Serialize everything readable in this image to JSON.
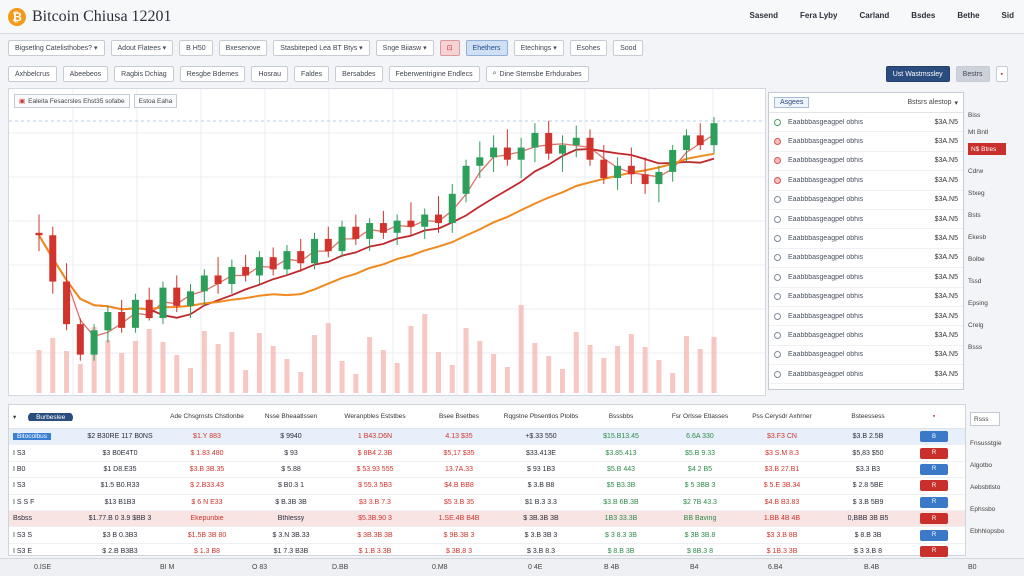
{
  "app": {
    "title": "Bitcoin Chiusa 12201",
    "logo_glyph": "₿"
  },
  "top_menu": [
    "Sasend",
    "Fera Lyby",
    "Carland",
    "Bsdes",
    "Bethe",
    "Sid"
  ],
  "toolbar1": [
    {
      "label": "Bigsetlng Catelisthobes? ▾"
    },
    {
      "label": "Adout Flatees ▾"
    },
    {
      "label": "B H50"
    },
    {
      "label": "Bxesenove"
    },
    {
      "label": "Stasbiteped Lea BT Btys ▾"
    },
    {
      "label": "Snge Biiasw ▾"
    },
    {
      "label": "Ehethers"
    },
    {
      "label": "Etechings ▾"
    },
    {
      "label": "Esohes"
    },
    {
      "label": "Sood"
    }
  ],
  "toolbar2": [
    {
      "label": "Axhbelcrus"
    },
    {
      "label": "Abeebeos"
    },
    {
      "label": "Ragbis Dchiag"
    },
    {
      "label": "Resgbe Bdemes"
    },
    {
      "label": "Hosrau"
    },
    {
      "label": "Faldes"
    },
    {
      "label": "Bersabdes"
    },
    {
      "label": "Feberwentrigine Endlecs"
    },
    {
      "label": "Dine Stemsbe Erhdurabes"
    }
  ],
  "toolbar2_right": {
    "primary": "Ust Wastmssley",
    "secondary": "Bestrs"
  },
  "chart_legend": {
    "series": "Ealeita Fesacrsles Ehst35 sofabe",
    "ma": "Estoa Eaha"
  },
  "colors": {
    "up": "#2e9e5b",
    "down": "#d0342c",
    "ma_fast": "#e0706a",
    "ma_mid": "#c0272d",
    "ma_slow": "#f08a1e",
    "volume": "#f4b4b0"
  },
  "chart_data": {
    "type": "candlestick",
    "title": "",
    "candles": [
      [
        200,
        215,
        185,
        198
      ],
      [
        198,
        205,
        150,
        160
      ],
      [
        160,
        175,
        120,
        125
      ],
      [
        125,
        130,
        95,
        100
      ],
      [
        100,
        125,
        95,
        120
      ],
      [
        120,
        140,
        110,
        135
      ],
      [
        135,
        145,
        118,
        122
      ],
      [
        122,
        150,
        118,
        145
      ],
      [
        145,
        155,
        128,
        130
      ],
      [
        130,
        160,
        125,
        155
      ],
      [
        155,
        165,
        135,
        140
      ],
      [
        140,
        158,
        130,
        152
      ],
      [
        152,
        170,
        140,
        165
      ],
      [
        165,
        180,
        150,
        158
      ],
      [
        158,
        178,
        150,
        172
      ],
      [
        172,
        182,
        160,
        165
      ],
      [
        165,
        185,
        158,
        180
      ],
      [
        180,
        188,
        165,
        170
      ],
      [
        170,
        190,
        165,
        185
      ],
      [
        185,
        195,
        168,
        175
      ],
      [
        175,
        200,
        170,
        195
      ],
      [
        195,
        205,
        180,
        185
      ],
      [
        185,
        210,
        180,
        205
      ],
      [
        205,
        215,
        190,
        195
      ],
      [
        195,
        212,
        185,
        208
      ],
      [
        208,
        218,
        195,
        200
      ],
      [
        200,
        215,
        190,
        210
      ],
      [
        210,
        225,
        198,
        205
      ],
      [
        205,
        220,
        195,
        215
      ],
      [
        215,
        230,
        200,
        208
      ],
      [
        208,
        240,
        200,
        232
      ],
      [
        232,
        260,
        225,
        255
      ],
      [
        255,
        275,
        245,
        262
      ],
      [
        262,
        280,
        250,
        270
      ],
      [
        270,
        285,
        255,
        260
      ],
      [
        260,
        278,
        245,
        270
      ],
      [
        270,
        290,
        258,
        282
      ],
      [
        282,
        292,
        260,
        265
      ],
      [
        265,
        280,
        250,
        272
      ],
      [
        272,
        288,
        262,
        278
      ],
      [
        278,
        285,
        255,
        260
      ],
      [
        260,
        272,
        240,
        245
      ],
      [
        245,
        262,
        235,
        255
      ],
      [
        255,
        270,
        240,
        248
      ],
      [
        248,
        262,
        232,
        240
      ],
      [
        240,
        255,
        225,
        250
      ],
      [
        250,
        272,
        242,
        268
      ],
      [
        268,
        285,
        258,
        280
      ],
      [
        280,
        290,
        268,
        272
      ],
      [
        272,
        295,
        265,
        290
      ]
    ],
    "moving_averages": [
      "fast",
      "mid",
      "slow"
    ]
  },
  "watchlist": {
    "tab": "Asgees",
    "sort_label": "Bstsrs alestop",
    "items": [
      {
        "name": "Eaabbbasgeagpel obhis",
        "price": "$3A.N5",
        "dot": "green"
      },
      {
        "name": "Eaabbbasgeagpel obhis",
        "price": "$3A.N5",
        "dot": "red"
      },
      {
        "name": "Eaabbbasgeagpel obhis",
        "price": "$3A.N5",
        "dot": "red"
      },
      {
        "name": "Eaabbbasgeagpel obhis",
        "price": "$3A.N5",
        "dot": "red"
      },
      {
        "name": "Eaabbbasgeagpel obhis",
        "price": "$3A.N5",
        "dot": "neutral"
      },
      {
        "name": "Eaabbbasgeagpel obhis",
        "price": "$3A.N5",
        "dot": "neutral"
      },
      {
        "name": "Eaabbbasgeagpel obhis",
        "price": "$3A.N5",
        "dot": "neutral"
      },
      {
        "name": "Eaabbbasgeagpel obhis",
        "price": "$3A.N5",
        "dot": "neutral"
      },
      {
        "name": "Eaabbbasgeagpel obhis",
        "price": "$3A.N5",
        "dot": "neutral"
      },
      {
        "name": "Eaabbbasgeagpel obhis",
        "price": "$3A.N5",
        "dot": "neutral"
      },
      {
        "name": "Eaabbbasgeagpel obhis",
        "price": "$3A.N5",
        "dot": "neutral"
      },
      {
        "name": "Eaabbbasgeagpel obhis",
        "price": "$3A.N5",
        "dot": "neutral"
      },
      {
        "name": "Eaabbbasgeagpel obhis",
        "price": "$3A.N5",
        "dot": "neutral"
      },
      {
        "name": "Eaabbbasgeagpel obhis",
        "price": "$3A.N5",
        "dot": "neutral"
      }
    ]
  },
  "side_strip": [
    "Biss",
    "Mt Bntl",
    "N$ Btres",
    "Cdrw",
    "Stxeg",
    "Bsts",
    "Ekesb",
    "Bolbe",
    "Tssd",
    "Epsing",
    "Crelg",
    "Bsss"
  ],
  "table": {
    "filter_label": "Burbeslee",
    "headers": [
      "",
      "Ade Chsgrnsts Chstlonbe",
      "Nsse Bheaatlssen",
      "Weranpbles Eststbes",
      "Bsee Bsetbes",
      "Rqgstne Pbsentlos Ptolbs",
      "Bsssbbs",
      "Fsr Orlsse Etlasses",
      "Pss Cerysdr Axhrner",
      "Bsteessess",
      "",
      ""
    ],
    "rows": [
      {
        "style": "sel",
        "cells": [
          "Bitocolbus",
          "$2 B30RE 117 B0NS",
          "$1.Y 883",
          "$ 9940",
          "1 B43.D6N",
          "4.13 $35",
          "+$.33 550",
          "$15.B13.45",
          "6.6A 330",
          "$3.F3 CN",
          "$3.B 2.5B",
          "B"
        ]
      },
      {
        "style": "",
        "cells": [
          "I S3",
          "$3 B0E4T0",
          "$ 1.83 480",
          "$ 93",
          "$ 8B4 2.3B",
          "$5,17 $35",
          "$33.413E",
          "$3.85.413",
          "$5.B 9.33",
          "$3 S.M 8.3",
          "$5,83 $50",
          "R"
        ]
      },
      {
        "style": "",
        "cells": [
          "I B0",
          "$1 D8.E35",
          "$3.B 3B.35",
          "$ 5.88",
          "$ 53.93 555",
          "13.7A.33",
          "$ 93 1B3",
          "$5.B 443",
          "$4 2 B5",
          "$3.B 27.B1",
          "$3.3 B3",
          "R"
        ]
      },
      {
        "style": "",
        "cells": [
          "I S3",
          "$1.5 B0.R33",
          "$ 2.B33.43",
          "$ B0.3 1",
          "$ 55.3 5B3",
          "$4.B BB8",
          "$ 3.B B8",
          "$5 B3.3B",
          "$ 5 3BB 3",
          "$ 5.E 3B.34",
          "$ 2.8 5BE",
          "R"
        ]
      },
      {
        "style": "",
        "cells": [
          "I S S F",
          "$13 B1B3",
          "$ 6 N E33",
          "$ B.3B 3B",
          "$3 3.B 7.3",
          "$5 3.B 35",
          "$1 B.3 3.3",
          "$3.B 6B.3B",
          "$2 7B 43.3",
          "$4.B B3.83",
          "$ 3.B 5B9",
          "R"
        ]
      },
      {
        "style": "pink",
        "cells": [
          "Bsbss",
          "$1.77.B 0 3.9 $BB 3",
          "Ekepunbie",
          "Bthlessy",
          "$5.3B.90 3",
          "1.SE.4B B4B",
          "$ 3B.3B 3B",
          "1B3 33.3B",
          "BB Baving",
          "1.BB 4B 4B",
          "0,BBB 3B B5",
          "R"
        ]
      },
      {
        "style": "",
        "cells": [
          "I S3 S",
          "$3 B 0.3B3",
          "$1.5B 3B 80",
          "$ 3.N 3B.33",
          "$ 3B.3B 3B",
          "$ 9B.3B 3",
          "$ 3.B 3B 3",
          "$ 3 8.3 3B",
          "$ 3B 3B.8",
          "$3 3.B 8B",
          "$ 8.B 3B",
          "R"
        ]
      },
      {
        "style": "",
        "cells": [
          "I S3 E",
          "$ 2.B B3B3",
          "$ 1.3 B8",
          "$1 7.3 B3B",
          "$ 1.B 3.3B",
          "$ 3B.8 3",
          "$ 3.B 8.3",
          "$ 8.B 3B",
          "$ 8B.3 8",
          "$ 1B.3 3B",
          "$ 3 3.B 8",
          "R"
        ]
      }
    ],
    "side_items": [
      "Rsss",
      "Fnsusstgie",
      "Algotbo",
      "Aebsbtlsto",
      "Ephssbo",
      "Ebhhlopsbo"
    ]
  },
  "footer": [
    "0.ISE",
    "BI M",
    "O 83",
    "D.BB",
    "0.M8",
    "0 4E",
    "B 4B",
    "B4",
    "6.B4",
    "B.4B",
    "B0"
  ]
}
